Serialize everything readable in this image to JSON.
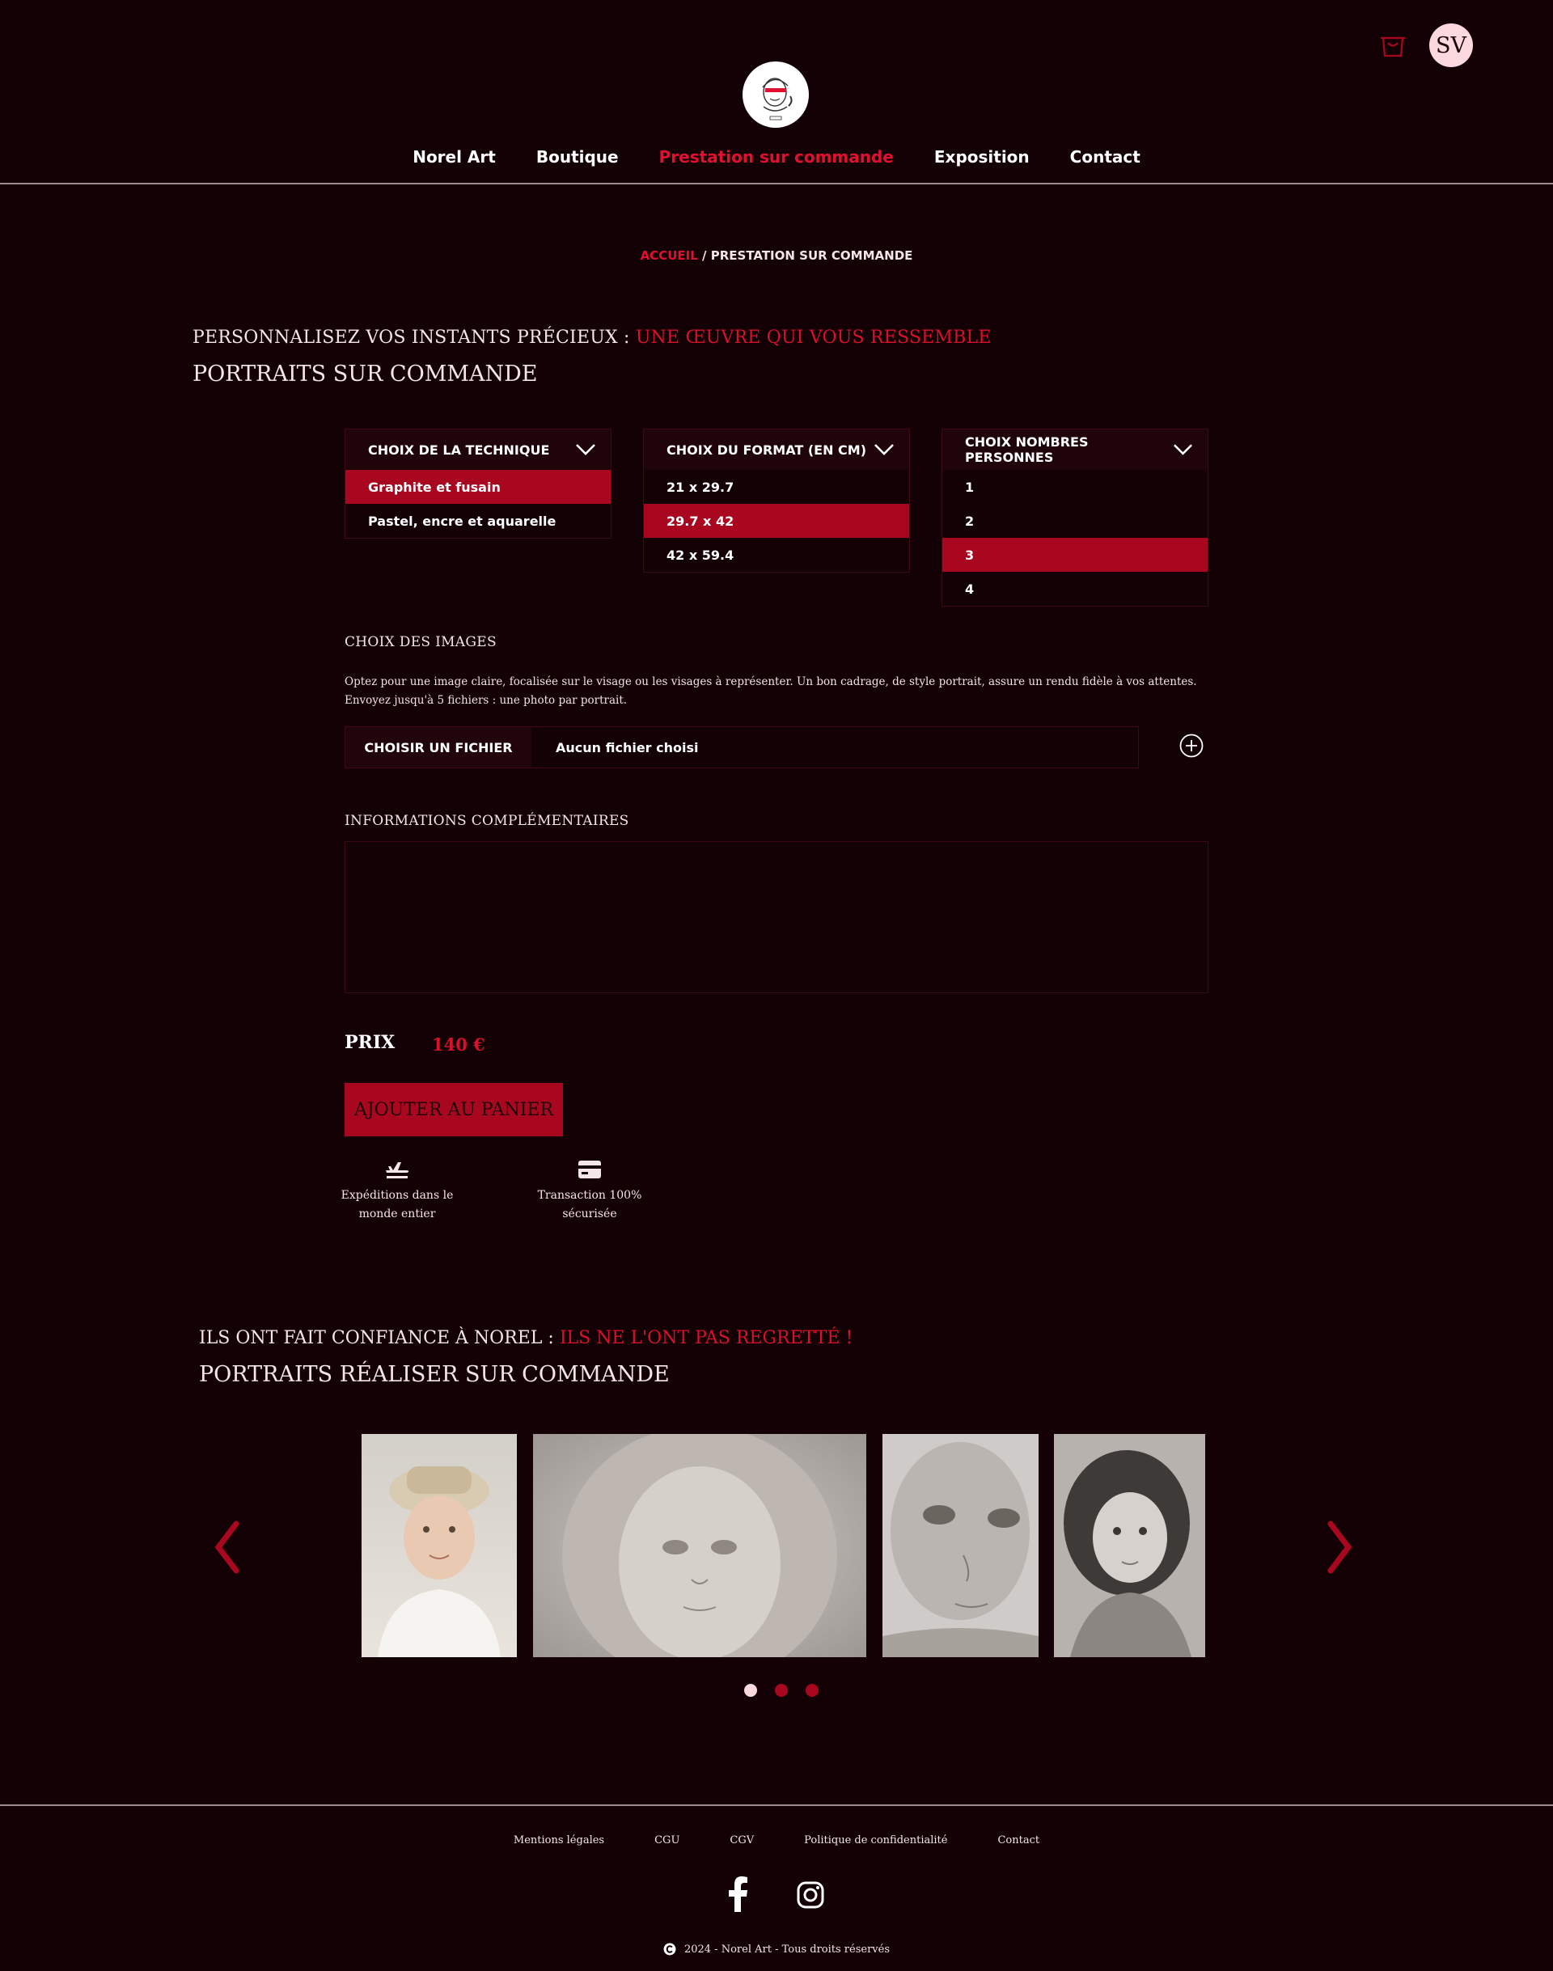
{
  "header": {
    "avatar_initials": "SV",
    "cart_icon": "shopping-bag-icon",
    "logo_icon": "norel-art-logo"
  },
  "nav": {
    "items": [
      "Norel Art",
      "Boutique",
      "Prestation sur commande",
      "Exposition",
      "Contact"
    ],
    "active": "Prestation sur commande"
  },
  "breadcrumb": {
    "home": "ACCUEIL",
    "separator": " / ",
    "current": "PRESTATION SUR COMMANDE"
  },
  "intro": {
    "line1_white": "PERSONNALISEZ VOS INSTANTS PRÉCIEUX : ",
    "line1_red": "UNE ŒUVRE QUI VOUS RESSEMBLE",
    "line2": "PORTRAITS SUR COMMANDE"
  },
  "options": {
    "technique": {
      "title": "CHOIX DE LA TECHNIQUE",
      "items": [
        "Graphite et fusain",
        "Pastel, encre et aquarelle"
      ],
      "selected": "Graphite et fusain"
    },
    "format": {
      "title": "CHOIX DU FORMAT (EN CM)",
      "items": [
        "21 x 29.7",
        "29.7 x 42",
        "42 x 59.4"
      ],
      "selected": "29.7 x 42"
    },
    "persons": {
      "title": "CHOIX NOMBRES PERSONNES",
      "items": [
        "1",
        "2",
        "3",
        "4"
      ],
      "selected": "3"
    }
  },
  "images": {
    "title": "CHOIX DES IMAGES",
    "description": "Optez pour une image claire, focalisée sur le visage ou les visages à représenter. Un bon cadrage, de style portrait, assure un rendu fidèle à vos attentes. Envoyez jusqu'à 5 fichiers : une photo par portrait.",
    "file_button": "CHOISIR UN FICHIER",
    "file_status": "Aucun fichier choisi",
    "add_icon": "plus-circle-icon"
  },
  "info": {
    "title": "INFORMATIONS COMPLÉMENTAIRES",
    "value": ""
  },
  "price": {
    "label": "PRIX",
    "value": "140 €"
  },
  "cart_button": "AJOUTER AU PANIER",
  "features": [
    {
      "icon": "plane-icon",
      "text": "Expéditions dans le monde entier"
    },
    {
      "icon": "credit-card-icon",
      "text": "Transaction 100% sécurisée"
    }
  ],
  "testimonials": {
    "line1_white": "ILS ONT FAIT CONFIANCE À NOREL : ",
    "line1_red": "ILS NE L'ONT PAS REGRETTÉ !",
    "line2": "PORTRAITS RÉALISER SUR COMMANDE",
    "carousel_pages": 3,
    "active_page": 1
  },
  "footer": {
    "links": [
      "Mentions légales",
      "CGU",
      "CGV",
      "Politique de confidentialité",
      "Contact"
    ],
    "social": [
      "facebook-icon",
      "instagram-icon"
    ],
    "copyright": "2024 - Norel Art - Tous droits réservés"
  },
  "colors": {
    "background": "#140105",
    "accent": "#a8071f",
    "accent_text": "#d8102c",
    "avatar_bg": "#fbd9de"
  }
}
